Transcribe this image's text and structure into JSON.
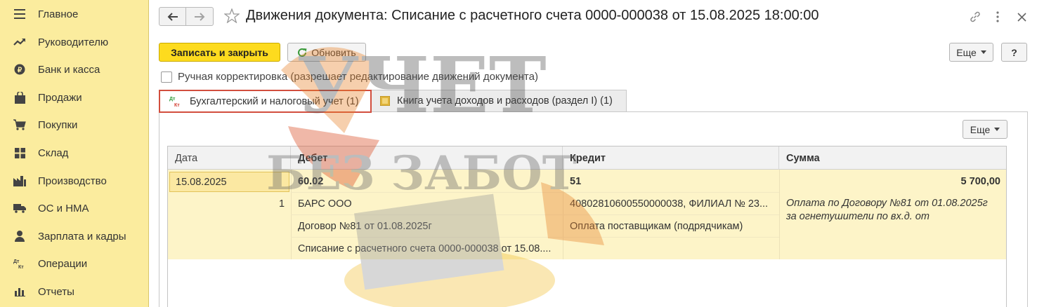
{
  "sidebar": {
    "items": [
      {
        "label": "Главное",
        "icon": "menu-icon"
      },
      {
        "label": "Руководителю",
        "icon": "trend-icon"
      },
      {
        "label": "Банк и касса",
        "icon": "coin-icon"
      },
      {
        "label": "Продажи",
        "icon": "bag-icon"
      },
      {
        "label": "Покупки",
        "icon": "cart-icon"
      },
      {
        "label": "Склад",
        "icon": "grid-icon"
      },
      {
        "label": "Производство",
        "icon": "factory-icon"
      },
      {
        "label": "ОС и НМА",
        "icon": "truck-icon"
      },
      {
        "label": "Зарплата и кадры",
        "icon": "person-icon"
      },
      {
        "label": "Операции",
        "icon": "dt-kt-icon"
      },
      {
        "label": "Отчеты",
        "icon": "bar-chart-icon"
      }
    ]
  },
  "header": {
    "title": "Движения документа: Списание с расчетного счета 0000-000038 от 15.08.2025 18:00:00"
  },
  "toolbar": {
    "save_close_label": "Записать и закрыть",
    "refresh_label": "Обновить",
    "more_label": "Еще",
    "help_label": "?"
  },
  "manual_correction": {
    "label": "Ручная корректировка (разрешает редактирование движений документа)",
    "checked": false
  },
  "tabs": [
    {
      "label": "Бухгалтерский и налоговый учет (1)",
      "active": true
    },
    {
      "label": "Книга учета доходов и расходов (раздел I) (1)",
      "active": false
    }
  ],
  "panel": {
    "more_label": "Еще"
  },
  "table": {
    "columns": [
      "Дата",
      "Дебет",
      "Кредит",
      "Сумма"
    ],
    "row": {
      "date": "15.08.2025",
      "line_no": "1",
      "debit_account": "60.02",
      "debit_sub1": "БАРС ООО",
      "debit_sub2": "Договор №81 от 01.08.2025г",
      "debit_sub3": "Списание с расчетного счета 0000-000038 от 15.08....",
      "credit_account": "51",
      "credit_sub1": "40802810600550000038, ФИЛИАЛ № 23...",
      "credit_sub2": "Оплата поставщикам (подрядчикам)",
      "amount": "5 700,00",
      "description": "Оплата по Договору №81 от 01.08.2025г за огнетушители по вх.д.  от"
    }
  },
  "watermark": {
    "line1": "УЧЕТ",
    "line2": "БЕЗ ЗАБОТ"
  },
  "colors": {
    "sidebar_bg": "#fbec9e",
    "primary_button": "#fddb1e",
    "row_highlight": "#fdf4c8",
    "active_tab_border": "#d24e3e"
  }
}
